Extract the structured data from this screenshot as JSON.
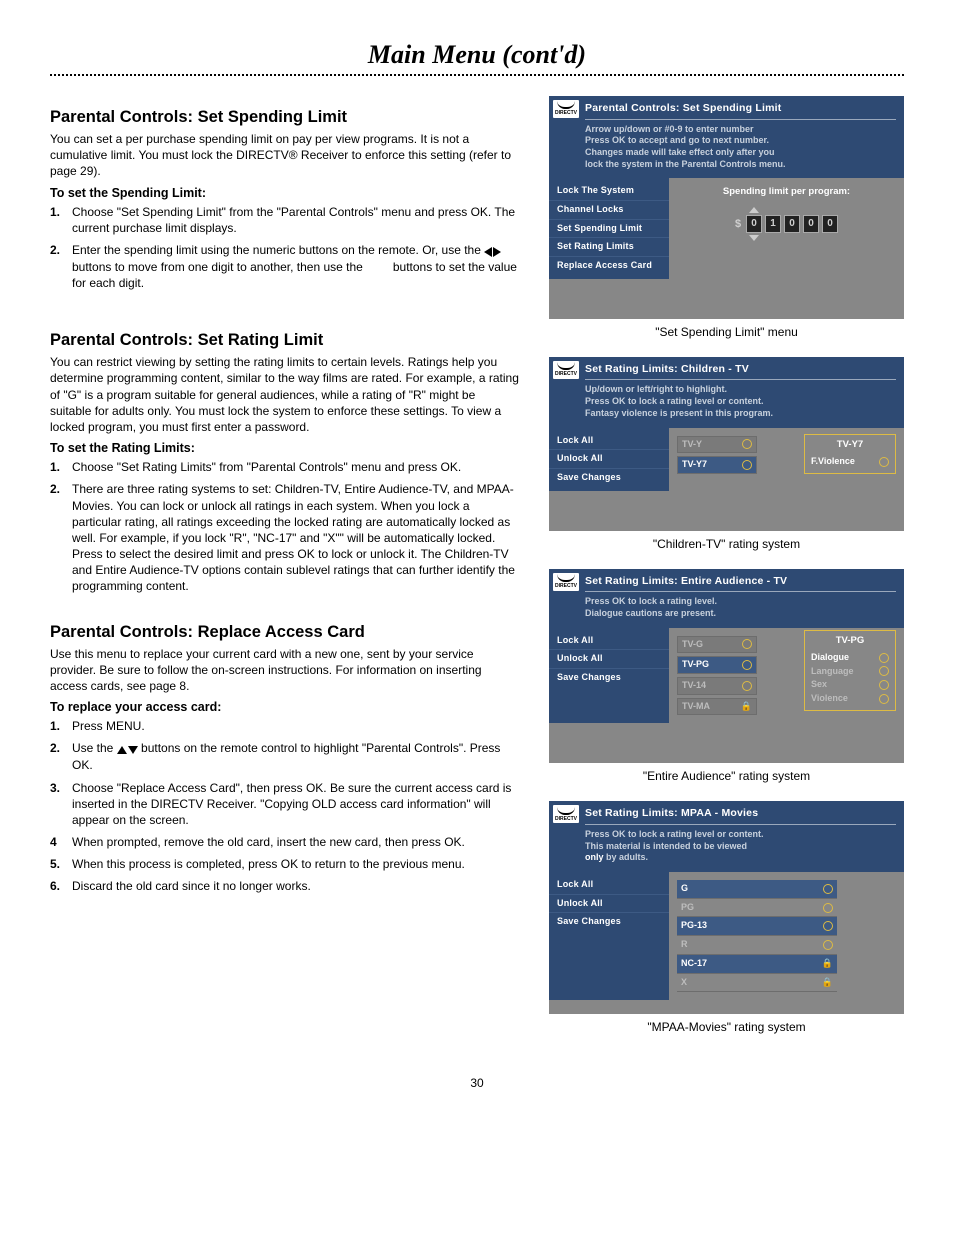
{
  "page_title": "Main Menu (cont'd)",
  "page_number": "30",
  "sections": {
    "spending": {
      "heading": "Parental Controls: Set Spending Limit",
      "intro": "You can set a per purchase spending limit on pay per view programs. It is not a cumulative limit. You must lock the DIRECTV® Receiver to enforce this setting (refer to page 29).",
      "subhead": "To set the Spending Limit:",
      "steps": [
        "Choose \"Set Spending Limit\" from the \"Parental Controls\" menu and press OK. The current purchase limit displays.",
        "Enter the spending limit using the numeric buttons on the remote. Or, use the ◀ ▶ buttons to move from one digit to another, then use the buttons to set the value for each digit."
      ]
    },
    "rating": {
      "heading": "Parental Controls: Set Rating Limit",
      "intro": "You can restrict viewing by setting the rating limits to certain levels. Ratings help you determine programming content, similar to the way films are rated. For example, a rating of \"G\" is a program suitable for general audiences, while a rating of \"R\" might be suitable for adults only. You must lock the system to enforce these settings. To view a locked program, you must first enter a password.",
      "subhead": "To set the Rating Limits:",
      "steps": [
        "Choose \"Set Rating Limits\" from \"Parental Controls\" menu and press OK.",
        "There are three rating systems to set: Children-TV, Entire Audience-TV, and MPAA-Movies. You can lock or unlock all ratings in each system. When you lock a particular rating, all ratings exceeding the locked rating are automatically locked as well. For example, if you lock \"R\", \"NC-17\" and \"X\"\" will be automatically locked. Press to select the desired limit and press OK to lock or unlock it. The Children-TV and Entire Audience-TV options contain sublevel ratings that can further identify the programming content."
      ]
    },
    "replace": {
      "heading": "Parental Controls: Replace Access Card",
      "intro": "Use this menu to replace your current card with a new one, sent by your service provider. Be sure to follow the on-screen instructions. For information on inserting access cards, see page 8.",
      "subhead": "To replace your access card:",
      "steps": [
        "Press MENU.",
        "Use the ▲▼ buttons on the remote control to highlight \"Parental Controls\". Press OK.",
        "Choose \"Replace Access Card\", then press OK. Be sure the current access card is inserted in the DIRECTV Receiver. \"Copying OLD access card information\" will appear on the screen.",
        "When prompted, remove the old card, insert the new card, then press OK.",
        "When this process is completed, press OK to return to the previous menu.",
        "Discard the old card since it no longer works."
      ],
      "step4_num": "4",
      "step_nums": [
        "1.",
        "2.",
        "3.",
        "4",
        "5.",
        "6."
      ]
    }
  },
  "ui_spending": {
    "title": "Parental Controls: Set Spending Limit",
    "desc1": "Arrow up/down or #0-9 to enter number",
    "desc2": "Press OK to accept and go to next number.",
    "desc3": "Changes made will take effect only after you",
    "desc4": "lock the system in the Parental Controls menu.",
    "sidebar": [
      "Lock The System",
      "Channel Locks",
      "Set Spending Limit",
      "Set Rating Limits",
      "Replace Access Card"
    ],
    "label": "Spending limit per program:",
    "dollar": "$",
    "digits": [
      "0",
      "1",
      "0",
      "0",
      "0"
    ],
    "caption": "\"Set Spending Limit\" menu"
  },
  "ui_children": {
    "title": "Set Rating Limits: Children - TV",
    "desc1": "Up/down or left/right to highlight.",
    "desc2": "Press OK to lock a rating level or content.",
    "desc3": "Fantasy violence is present in this program.",
    "sidebar": [
      "Lock All",
      "Unlock All",
      "Save Changes"
    ],
    "ratings": [
      "TV-Y",
      "TV-Y7"
    ],
    "panel_title": "TV-Y7",
    "panel_row": "F.Violence",
    "caption": "\"Children-TV\" rating system"
  },
  "ui_entire": {
    "title": "Set Rating Limits: Entire Audience - TV",
    "desc1": "Press OK to lock a rating level.",
    "desc2": "Dialogue cautions are present.",
    "sidebar": [
      "Lock All",
      "Unlock All",
      "Save Changes"
    ],
    "ratings": [
      "TV-G",
      "TV-PG",
      "TV-14",
      "TV-MA"
    ],
    "panel_title": "TV-PG",
    "panel_rows": [
      "Dialogue",
      "Language",
      "Sex",
      "Violence"
    ],
    "caption": "\"Entire Audience\" rating system"
  },
  "ui_mpaa": {
    "title": "Set Rating Limits: MPAA - Movies",
    "desc1": "Press OK to lock a rating level or content.",
    "desc2a": "This material is intended to be viewed",
    "desc2b": "only",
    "desc2c": " by adults.",
    "sidebar": [
      "Lock All",
      "Unlock All",
      "Save Changes"
    ],
    "ratings": [
      "G",
      "PG",
      "PG-13",
      "R",
      "NC-17",
      "X"
    ],
    "caption": "\"MPAA-Movies\" rating system"
  },
  "logo_text": "DIRECTV"
}
